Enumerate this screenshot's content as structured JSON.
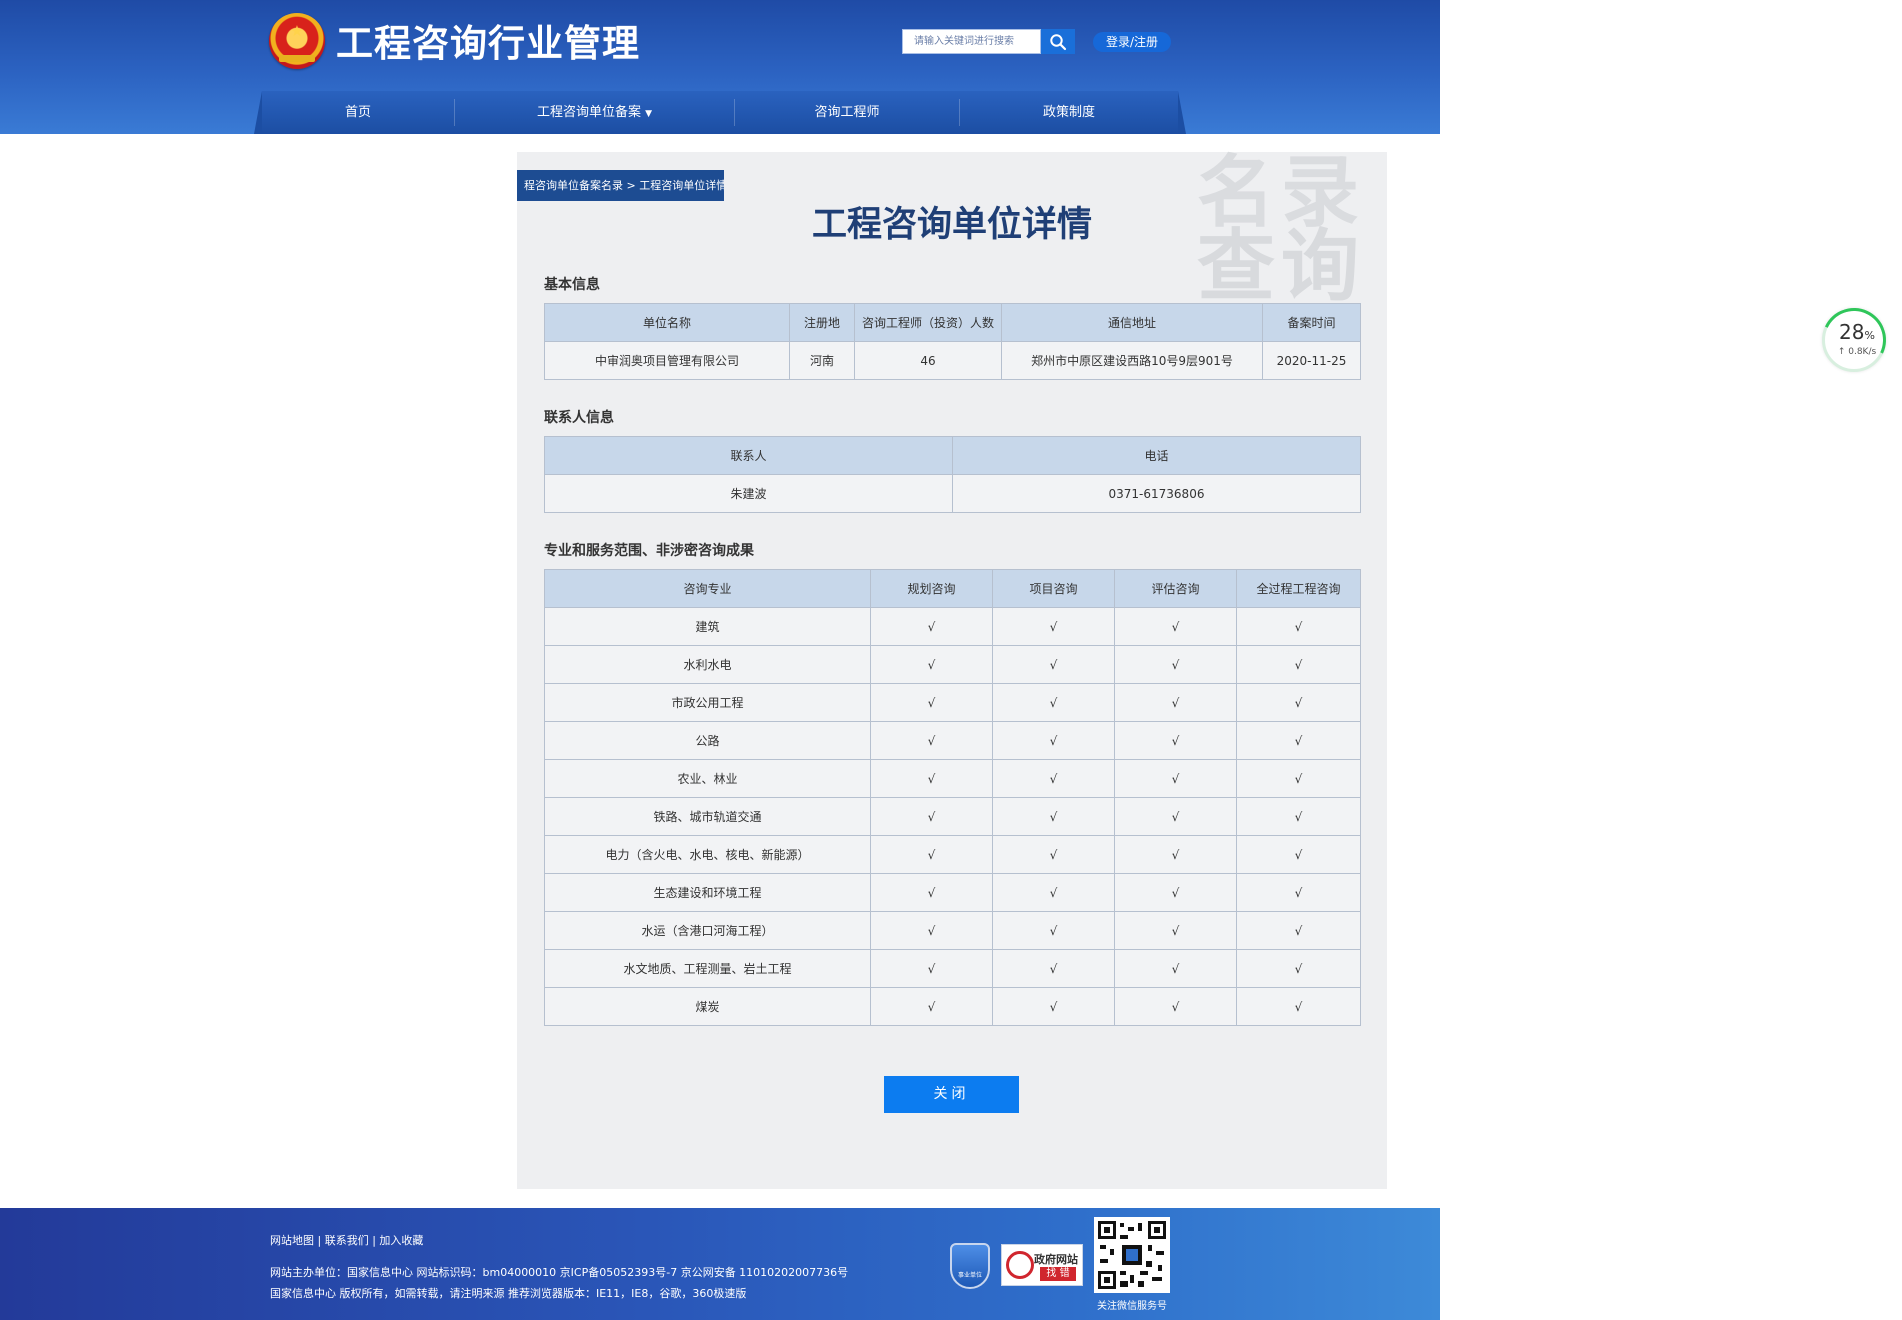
{
  "header": {
    "site_title": "工程咨询行业管理",
    "search_placeholder": "请输入关键词进行搜索",
    "login_label": "登录/注册"
  },
  "nav": {
    "items": [
      {
        "label": "首页"
      },
      {
        "label": "工程咨询单位备案"
      },
      {
        "label": "咨询工程师"
      },
      {
        "label": "政策制度"
      }
    ]
  },
  "main": {
    "breadcrumb": "程咨询单位备案名录 > 工程咨询单位详情",
    "title": "工程咨询单位详情",
    "watermark_line1": "名录",
    "watermark_line2": "查询",
    "basic": {
      "section_title": "基本信息",
      "headers": [
        "单位名称",
        "注册地",
        "咨询工程师（投资）人数",
        "通信地址",
        "备案时间"
      ],
      "row": [
        "中审润奥项目管理有限公司",
        "河南",
        "46",
        "郑州市中原区建设西路10号9层901号",
        "2020-11-25"
      ]
    },
    "contact": {
      "section_title": "联系人信息",
      "headers": [
        "联系人",
        "电话"
      ],
      "row": [
        "朱建波",
        "0371-61736806"
      ]
    },
    "scope": {
      "section_title": "专业和服务范围、非涉密咨询成果",
      "headers": [
        "咨询专业",
        "规划咨询",
        "项目咨询",
        "评估咨询",
        "全过程工程咨询"
      ],
      "rows": [
        [
          "建筑",
          "√",
          "√",
          "√",
          "√"
        ],
        [
          "水利水电",
          "√",
          "√",
          "√",
          "√"
        ],
        [
          "市政公用工程",
          "√",
          "√",
          "√",
          "√"
        ],
        [
          "公路",
          "√",
          "√",
          "√",
          "√"
        ],
        [
          "农业、林业",
          "√",
          "√",
          "√",
          "√"
        ],
        [
          "铁路、城市轨道交通",
          "√",
          "√",
          "√",
          "√"
        ],
        [
          "电力（含火电、水电、核电、新能源）",
          "√",
          "√",
          "√",
          "√"
        ],
        [
          "生态建设和环境工程",
          "√",
          "√",
          "√",
          "√"
        ],
        [
          "水运（含港口河海工程）",
          "√",
          "√",
          "√",
          "√"
        ],
        [
          "水文地质、工程测量、岩土工程",
          "√",
          "√",
          "√",
          "√"
        ],
        [
          "煤炭",
          "√",
          "√",
          "√",
          "√"
        ]
      ]
    },
    "close_label": "关闭"
  },
  "speed_widget": {
    "percent": "28",
    "percent_unit": "%",
    "rate": "↑ 0.8K/s"
  },
  "footer": {
    "links": "网站地图 | 联系我们 | 加入收藏",
    "line1": "网站主办单位：国家信息中心    网站标识码：bm04000010    京ICP备05052393号-7    京公网安备 11010202007736号",
    "line2": "国家信息中心 版权所有，如需转载，请注明来源    推荐浏览器版本：IE11，IE8，谷歌，360极速版",
    "shield_text": "事业单位",
    "gov_badge_line1": "政府网站",
    "gov_badge_line2": "找 错",
    "qr_caption": "关注微信服务号"
  },
  "colors": {
    "header_blue": "#2c63c2",
    "nav_blue": "#1c4ea3",
    "breadcrumb_bg": "#1d4c92",
    "title_color": "#1f3f76",
    "table_header_bg": "#c7d7ea",
    "close_button": "#0c7cf0",
    "footer_blue": "#2a56b8"
  },
  "icons": {
    "search": "search-icon",
    "dropdown": "caret-down-icon",
    "emblem": "national-emblem-icon"
  }
}
